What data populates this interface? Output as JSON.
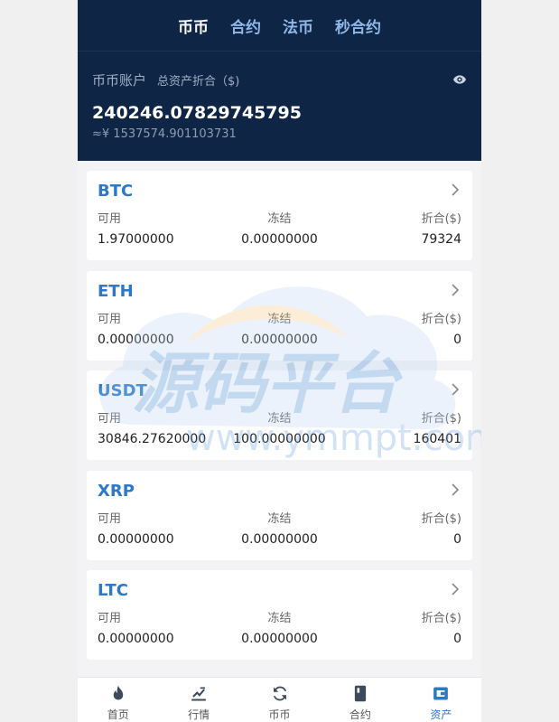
{
  "tabs": [
    {
      "label": "币币",
      "active": true
    },
    {
      "label": "合约",
      "active": false
    },
    {
      "label": "法币",
      "active": false
    },
    {
      "label": "秒合约",
      "active": false
    }
  ],
  "account": {
    "label": "币币账户",
    "sub_label": "总资产折合（$)",
    "total": "240246.07829745795",
    "approx": "≈¥ 1537574.901103731"
  },
  "columns": {
    "available": "可用",
    "frozen": "冻结",
    "converted": "折合($)"
  },
  "assets": [
    {
      "coin": "BTC",
      "available": "1.97000000",
      "frozen": "0.00000000",
      "converted": "79324"
    },
    {
      "coin": "ETH",
      "available": "0.00000000",
      "frozen": "0.00000000",
      "converted": "0"
    },
    {
      "coin": "USDT",
      "available": "30846.27620000",
      "frozen": "100.00000000",
      "converted": "160401"
    },
    {
      "coin": "XRP",
      "available": "0.00000000",
      "frozen": "0.00000000",
      "converted": "0"
    },
    {
      "coin": "LTC",
      "available": "0.00000000",
      "frozen": "0.00000000",
      "converted": "0"
    }
  ],
  "watermark": {
    "text": "源码平台",
    "url": "www.ymmpt.com"
  },
  "bottom_nav": [
    {
      "label": "首页",
      "icon": "flame-icon",
      "active": false
    },
    {
      "label": "行情",
      "icon": "market-icon",
      "active": false
    },
    {
      "label": "币币",
      "icon": "exchange-icon",
      "active": false
    },
    {
      "label": "合约",
      "icon": "contract-icon",
      "active": false
    },
    {
      "label": "资产",
      "icon": "wallet-icon",
      "active": true
    }
  ],
  "colors": {
    "header_bg": "#0f2545",
    "accent": "#2c78c9",
    "page_bg": "#f3f3f6"
  }
}
